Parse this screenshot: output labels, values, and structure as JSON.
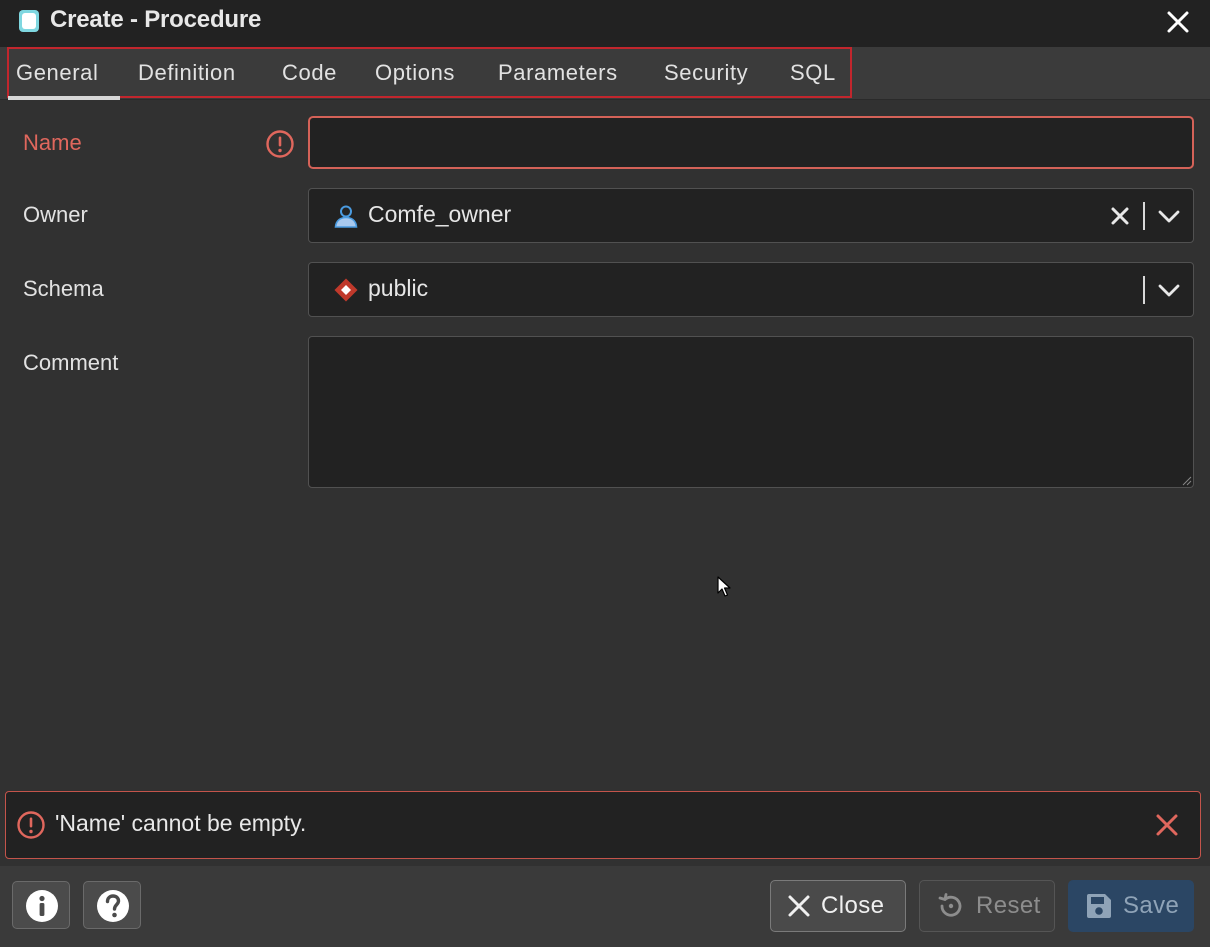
{
  "window": {
    "title": "Create - Procedure",
    "icon": "procedure-icon",
    "close_icon": "close-icon"
  },
  "tabs": [
    {
      "label": "General",
      "active": true
    },
    {
      "label": "Definition",
      "active": false
    },
    {
      "label": "Code",
      "active": false
    },
    {
      "label": "Options",
      "active": false
    },
    {
      "label": "Parameters",
      "active": false
    },
    {
      "label": "Security",
      "active": false
    },
    {
      "label": "SQL",
      "active": false
    }
  ],
  "form": {
    "name": {
      "label": "Name",
      "value": "",
      "has_error": true
    },
    "owner": {
      "label": "Owner",
      "value": "Comfe_owner",
      "icon": "user-icon"
    },
    "schema": {
      "label": "Schema",
      "value": "public",
      "icon": "schema-icon"
    },
    "comment": {
      "label": "Comment",
      "value": ""
    }
  },
  "error": {
    "message": "'Name' cannot be empty.",
    "icon": "warning-icon"
  },
  "footer": {
    "info_icon": "info-icon",
    "help_icon": "help-icon",
    "close_label": "Close",
    "reset_label": "Reset",
    "save_label": "Save"
  },
  "colors": {
    "error": "#e0675d",
    "tab_highlight_border": "#c2262d",
    "save_button": "#2b4664"
  }
}
